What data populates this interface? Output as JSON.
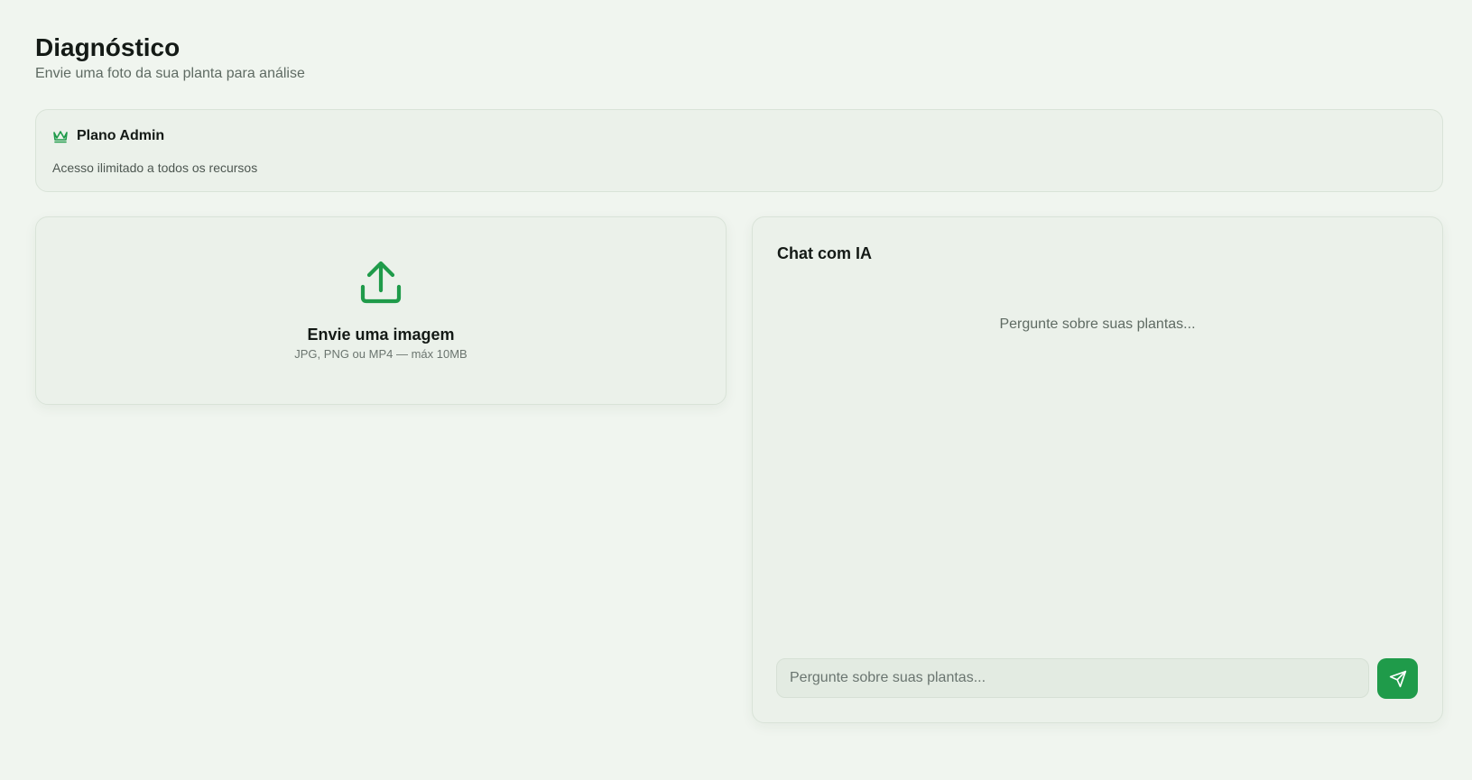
{
  "header": {
    "title": "Diagnóstico",
    "subtitle": "Envie uma foto da sua planta para análise"
  },
  "plan": {
    "icon": "crown-icon",
    "title": "Plano Admin",
    "description": "Acesso ilimitado a todos os recursos"
  },
  "upload": {
    "icon": "upload-icon",
    "title": "Envie uma imagem",
    "hint": "JPG, PNG ou MP4 — máx 10MB"
  },
  "chat": {
    "title": "Chat com IA",
    "empty_message": "Pergunte sobre suas plantas...",
    "input_value": "",
    "input_placeholder": "Pergunte sobre suas plantas...",
    "send_icon": "send-icon"
  },
  "colors": {
    "background": "#f0f5ef",
    "card": "#ebf1ea",
    "accent": "#1f9b4a",
    "text": "#141a16",
    "muted": "#5f6b63"
  }
}
